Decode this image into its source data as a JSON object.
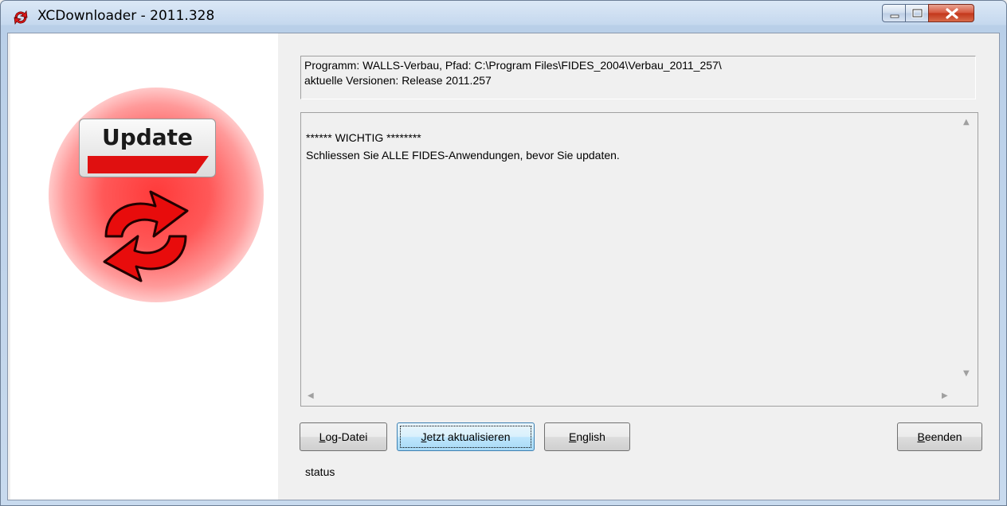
{
  "window": {
    "title": "XCDownloader - 2011.328"
  },
  "sidebar": {
    "badge_text": "Update"
  },
  "info": {
    "line1": "Programm: WALLS-Verbau, Pfad: C:\\Program Files\\FIDES_2004\\Verbau_2011_257\\",
    "line2": "aktuelle Versionen: Release 2011.257"
  },
  "memo": {
    "line1": "****** WICHTIG ********",
    "line2": "Schliessen Sie ALLE FIDES-Anwendungen, bevor Sie updaten."
  },
  "buttons": {
    "log_first": "L",
    "log_rest": "og-Datei",
    "update_first": "J",
    "update_rest": "etzt aktualisieren",
    "english_first": "E",
    "english_rest": "nglish",
    "quit_first": "B",
    "quit_rest": "eenden"
  },
  "status": {
    "text": "status"
  },
  "icons": [
    "app-icon",
    "minimize-icon",
    "maximize-icon",
    "close-icon",
    "update-arrows-icon",
    "scroll-up-icon",
    "scroll-down-icon",
    "scroll-left-icon",
    "scroll-right-icon"
  ]
}
